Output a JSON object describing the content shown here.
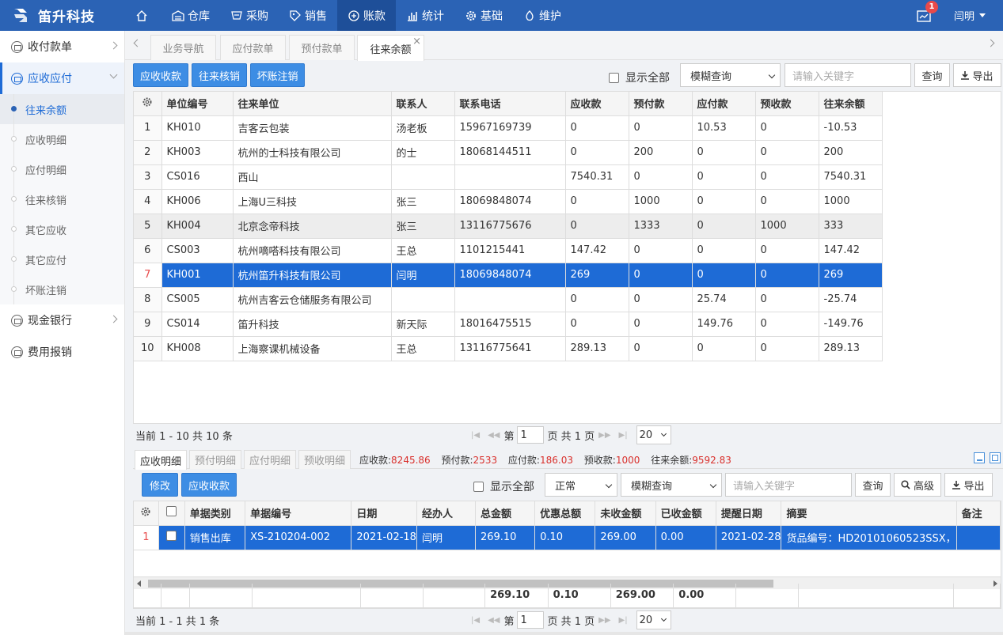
{
  "app": {
    "title": "笛升科技",
    "user": "闫明",
    "notifications": "1"
  },
  "nav": [
    {
      "label": "",
      "icon": "home-icon"
    },
    {
      "label": "仓库",
      "icon": "warehouse-icon"
    },
    {
      "label": "采购",
      "icon": "purchase-icon"
    },
    {
      "label": "销售",
      "icon": "sales-icon"
    },
    {
      "label": "账款",
      "icon": "account-icon"
    },
    {
      "label": "统计",
      "icon": "chart-icon"
    },
    {
      "label": "基础",
      "icon": "gear-icon"
    },
    {
      "label": "维护",
      "icon": "maintenance-icon"
    }
  ],
  "sidebar": {
    "groups": [
      {
        "label": "收付款单"
      },
      {
        "label": "应收应付"
      },
      {
        "label": "现金银行"
      },
      {
        "label": "费用报销"
      }
    ],
    "sub": [
      "往来余额",
      "应收明细",
      "应付明细",
      "往来核销",
      "其它应收",
      "其它应付",
      "坏账注销"
    ]
  },
  "tabs": [
    "业务导航",
    "应付款单",
    "预付款单",
    "往来余额"
  ],
  "toolbar": {
    "btn1": "应收收款",
    "btn2": "往来核销",
    "btn3": "坏账注销",
    "show_all": "显示全部",
    "query_mode": "模糊查询",
    "keyword_placeholder": "请输入关键字",
    "query": "查询",
    "export": "导出"
  },
  "balance_table": {
    "columns": [
      "单位编号",
      "往来单位",
      "联系人",
      "联系电话",
      "应收款",
      "预付款",
      "应付款",
      "预收款",
      "往来余额"
    ],
    "rows": [
      [
        "1",
        "KH010",
        "吉客云包装",
        "汤老板",
        "15967169739",
        "0",
        "0",
        "10.53",
        "0",
        "-10.53"
      ],
      [
        "2",
        "KH003",
        "杭州的士科技有限公司",
        "的士",
        "18068144511",
        "0",
        "200",
        "0",
        "0",
        "200"
      ],
      [
        "3",
        "CS016",
        "西山",
        "",
        "",
        "7540.31",
        "0",
        "0",
        "0",
        "7540.31"
      ],
      [
        "4",
        "KH006",
        "上海U三科技",
        "张三",
        "18069848074",
        "0",
        "1000",
        "0",
        "0",
        "1000"
      ],
      [
        "5",
        "KH004",
        "北京念帝科技",
        "张三",
        "13116775676",
        "0",
        "1333",
        "0",
        "1000",
        "333"
      ],
      [
        "6",
        "CS003",
        "杭州嘀嗒科技有限公司",
        "王总",
        "1101215441",
        "147.42",
        "0",
        "0",
        "0",
        "147.42"
      ],
      [
        "7",
        "KH001",
        "杭州笛升科技有限公司",
        "闫明",
        "18069848074",
        "269",
        "0",
        "0",
        "0",
        "269"
      ],
      [
        "8",
        "CS005",
        "杭州吉客云仓储服务有限公司",
        "",
        "",
        "0",
        "0",
        "25.74",
        "0",
        "-25.74"
      ],
      [
        "9",
        "CS014",
        "笛升科技",
        "新天际",
        "18016475515",
        "0",
        "0",
        "149.76",
        "0",
        "-149.76"
      ],
      [
        "10",
        "KH008",
        "上海察课机械设备",
        "王总",
        "13116775641",
        "289.13",
        "0",
        "0",
        "0",
        "289.13"
      ]
    ]
  },
  "pager1": {
    "info": "当前 1 - 10 共 10 条",
    "page_prefix": "第",
    "page": "1",
    "page_suffix": "页 共 1 页",
    "size": "20"
  },
  "subtabs": [
    "应收明细",
    "预付明细",
    "应付明细",
    "预收明细"
  ],
  "summary": {
    "receivable_label": "应收款:",
    "receivable": "8245.86",
    "prepaid_label": "预付款:",
    "prepaid": "2533",
    "payable_label": "应付款:",
    "payable": "186.03",
    "advance_label": "预收款:",
    "advance": "1000",
    "balance_label": "往来余额:",
    "balance": "9592.83"
  },
  "toolbar2": {
    "edit": "修改",
    "collect": "应收收款",
    "show_all": "显示全部",
    "status": "正常",
    "query_mode": "模糊查询",
    "keyword_placeholder": "请输入关键字",
    "query": "查询",
    "advanced": "高级",
    "export": "导出"
  },
  "detail_table": {
    "columns": [
      "单据类别",
      "单据编号",
      "日期",
      "经办人",
      "总金额",
      "优惠总额",
      "未收金额",
      "已收金额",
      "提醒日期",
      "摘要",
      "备注"
    ],
    "rows": [
      [
        "1",
        "销售出库",
        "XS-210204-002",
        "2021-02-18",
        "闫明",
        "269.10",
        "0.10",
        "269.00",
        "0.00",
        "2021-02-28",
        "货品编号：HD20101060523SSX，",
        ""
      ]
    ],
    "totals": [
      "269.10",
      "0.10",
      "269.00",
      "0.00"
    ]
  },
  "pager2": {
    "info": "当前 1 - 1 共 1 条",
    "page_prefix": "第",
    "page": "1",
    "page_suffix": "页 共 1 页",
    "size": "20"
  }
}
